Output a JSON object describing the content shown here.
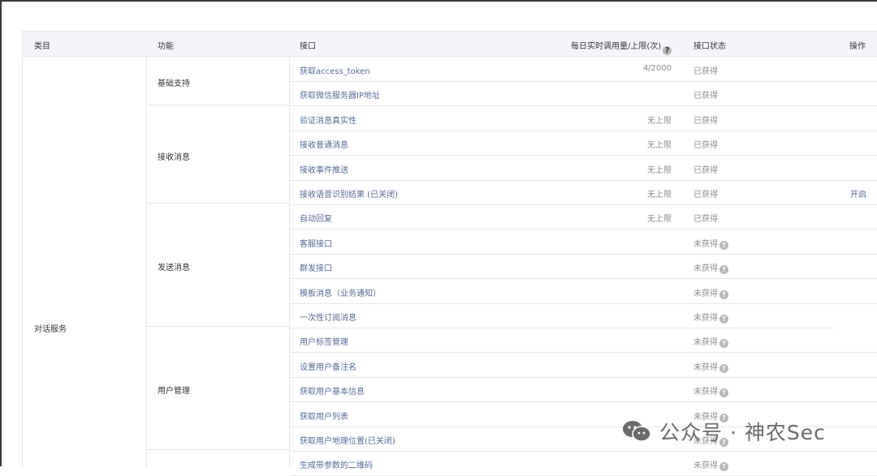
{
  "table": {
    "headers": {
      "category": "类目",
      "feature": "功能",
      "interface": "接口",
      "quota": "每日实时调用量/上限(次)",
      "status": "接口状态",
      "action": "操作"
    },
    "category": "对话服务",
    "groups": [
      {
        "feature": "基础支持"
      },
      {
        "feature": "接收消息"
      },
      {
        "feature": "发送消息"
      },
      {
        "feature": "用户管理"
      }
    ],
    "rows": [
      {
        "name": "获取access_token",
        "quota": "4/2000",
        "status": "已获得",
        "action": ""
      },
      {
        "name": "获取微信服务器IP地址",
        "quota": "",
        "status": "已获得",
        "action": ""
      },
      {
        "name": "验证消息真实性",
        "quota": "无上限",
        "status": "已获得",
        "action": ""
      },
      {
        "name": "接收普通消息",
        "quota": "无上限",
        "status": "已获得",
        "action": ""
      },
      {
        "name": "接收事件推送",
        "quota": "无上限",
        "status": "已获得",
        "action": ""
      },
      {
        "name": "接收语音识别结果 (已关闭)",
        "quota": "无上限",
        "status": "已获得",
        "action": "开启"
      },
      {
        "name": "自动回复",
        "quota": "无上限",
        "status": "已获得",
        "action": ""
      },
      {
        "name": "客服接口",
        "quota": "",
        "status": "未获得",
        "action": ""
      },
      {
        "name": "群发接口",
        "quota": "",
        "status": "未获得",
        "action": ""
      },
      {
        "name": "模板消息（业务通知）",
        "quota": "",
        "status": "未获得",
        "action": ""
      },
      {
        "name": "一次性订阅消息",
        "quota": "",
        "status": "未获得",
        "action": ""
      },
      {
        "name": "用户标签管理",
        "quota": "",
        "status": "未获得",
        "action": ""
      },
      {
        "name": "设置用户备注名",
        "quota": "",
        "status": "未获得",
        "action": ""
      },
      {
        "name": "获取用户基本信息",
        "quota": "",
        "status": "未获得",
        "action": ""
      },
      {
        "name": "获取用户列表",
        "quota": "",
        "status": "未获得",
        "action": ""
      },
      {
        "name": "获取用户地理位置(已关闭)",
        "quota": "",
        "status": "未获得",
        "action": ""
      },
      {
        "name": "生成带参数的二维码",
        "quota": "",
        "status": "未获得",
        "action": ""
      }
    ]
  },
  "watermark": {
    "text": "公众号 · 神农Sec"
  },
  "icons": {
    "help": "question-circle-icon",
    "wechat": "wechat-logo-icon"
  },
  "colors": {
    "link": "#576b95",
    "muted": "#8d8d8d",
    "header_bg": "#f4f5f9",
    "border": "#e4e8eb"
  }
}
